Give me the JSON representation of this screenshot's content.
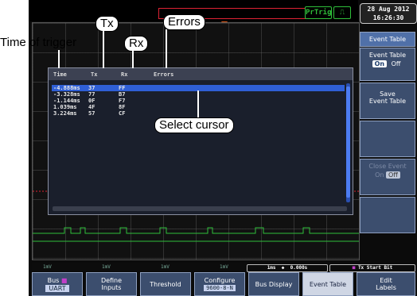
{
  "topbar": {
    "trigger_mode": "PrTrig",
    "edge_icon": "rising-pulse-icon",
    "date": "28 Aug 2012",
    "time": "16:26:30"
  },
  "event_table": {
    "columns": [
      "Time",
      "Tx",
      "Rx",
      "Errors"
    ],
    "rows": [
      {
        "time": "-4.888ms",
        "tx": "37",
        "rx": "FF",
        "errors": ""
      },
      {
        "time": "-3.328ms",
        "tx": "77",
        "rx": "B7",
        "errors": ""
      },
      {
        "time": "-1.144ms",
        "tx": "0F",
        "rx": "F7",
        "errors": ""
      },
      {
        "time": "1.039ms",
        "tx": "4F",
        "rx": "8F",
        "errors": ""
      },
      {
        "time": "3.224ms",
        "tx": "57",
        "rx": "CF",
        "errors": ""
      }
    ],
    "selected_index": 0
  },
  "side_menu": {
    "title": "Event Table",
    "event_table_label": "Event Table",
    "on": "On",
    "off": "Off",
    "save_label": "Save\nEvent Table",
    "dim_label": "Close Event",
    "dim_on": "On",
    "dim_off": "Off"
  },
  "status_bar": {
    "ch1": "1mV",
    "ch2": "1mV",
    "ch3": "1mV",
    "ch4": "1mV",
    "timebase": "1ms",
    "position": "0.000s",
    "trigger_desc": "Tx Start Bit"
  },
  "softkeys": {
    "bus_line1": "Bus",
    "bus_line2": "UART",
    "define_line1": "Define",
    "define_line2": "Inputs",
    "threshold": "Threshold",
    "configure_line1": "Configure",
    "configure_line2": "9600-8-N",
    "bus_display": "Bus Display",
    "event_table": "Event Table",
    "edit_line1": "Edit",
    "edit_line2": "Labels"
  },
  "annotations": {
    "tx": "Tx",
    "rx": "Rx",
    "errors": "Errors",
    "time_of_trigger": "Time of trigger",
    "select_cursor": "Select cursor"
  }
}
